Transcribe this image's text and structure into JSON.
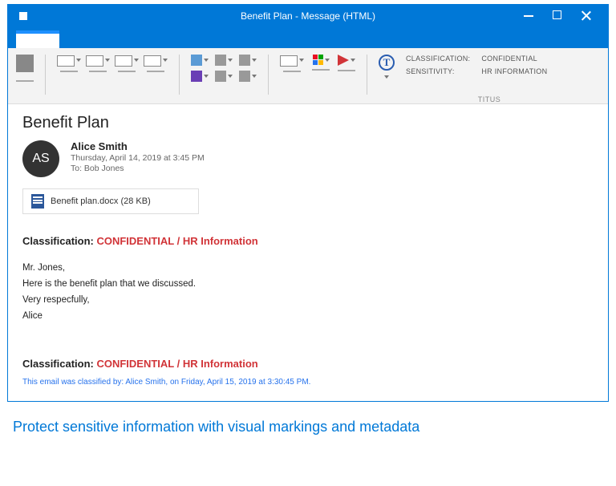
{
  "window": {
    "title": "Benefit Plan - Message (HTML)"
  },
  "ribbon": {
    "classification_label": "Classification:",
    "sensitivity_label": "Sensitivity:",
    "classification_value": "Confidential",
    "sensitivity_value": "HR Information",
    "group_name": "TITUS"
  },
  "message": {
    "subject": "Benefit Plan",
    "avatar_initials": "AS",
    "from_name": "Alice Smith",
    "sent_line": "Thursday, April 14, 2019 at 3:45 PM",
    "to_line": "To: Bob Jones",
    "attachment_name": "Benefit plan.docx (28 KB)",
    "classification_prefix": "Classification: ",
    "classification_value": "CONFIDENTIAL / HR Information",
    "body_greeting": "Mr. Jones,",
    "body_line1": "Here is the benefit plan that we discussed.",
    "body_close": "Very respecfully,",
    "body_sign": "Alice",
    "footer": "This email was classified by: Alice Smith, on Friday, April 15, 2019 at 3:30:45 PM."
  },
  "caption": "Protect sensitive information with visual markings and metadata"
}
